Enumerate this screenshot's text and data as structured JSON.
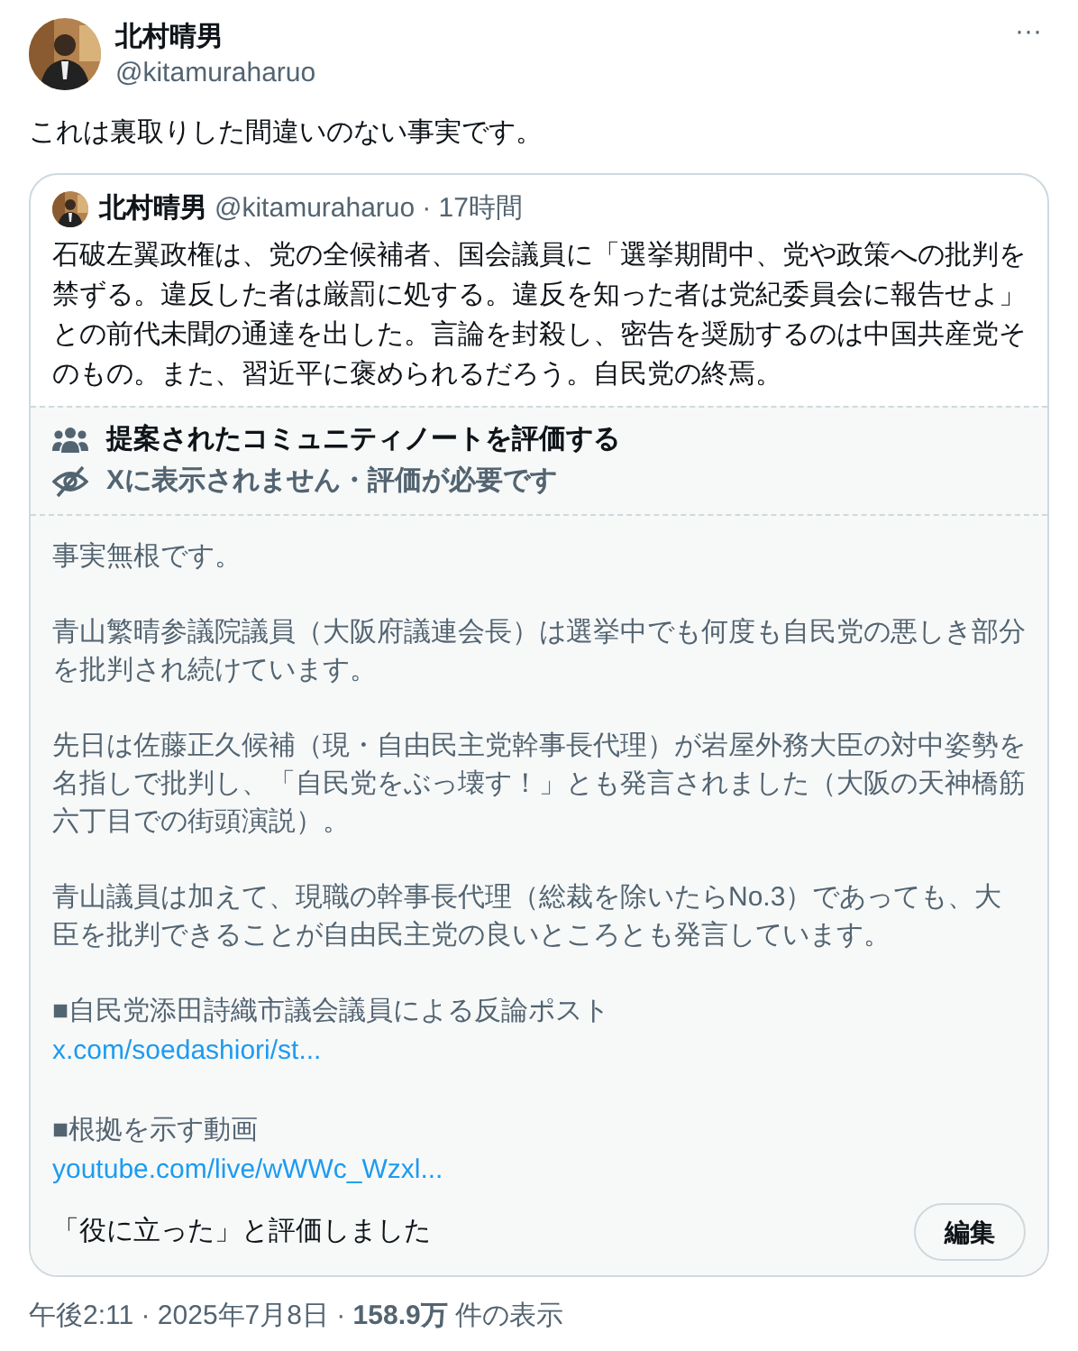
{
  "post": {
    "author": {
      "name": "北村晴男",
      "handle": "@kitamuraharuo"
    },
    "more": "···",
    "text": "これは裏取りした間違いのない事実です。"
  },
  "quote": {
    "author": {
      "name": "北村晴男",
      "handle": "@kitamuraharuo",
      "time": "· 17時間"
    },
    "text": "石破左翼政権は、党の全候補者、国会議員に「選挙期間中、党や政策への批判を禁ずる。違反した者は厳罰に処する。違反を知った者は党紀委員会に報告せよ」との前代未聞の通達を出した。言論を封殺し、密告を奨励するのは中国共産党そのもの。また、習近平に褒められるだろう。自民党の終焉。"
  },
  "note": {
    "header": "提案されたコミュニティノートを評価する",
    "status": "Xに表示されません・評価が必要です",
    "body": [
      {
        "kind": "text",
        "text": "事実無根です。"
      },
      {
        "kind": "text",
        "text": "青山繁晴参議院議員（大阪府議連会長）は選挙中でも何度も自民党の悪しき部分を批判され続けています。"
      },
      {
        "kind": "text",
        "text": "先日は佐藤正久候補（現・自由民主党幹事長代理）が岩屋外務大臣の対中姿勢を名指しで批判し、「自民党をぶっ壊す！」とも発言されました（大阪の天神橋筋六丁目での街頭演説）。"
      },
      {
        "kind": "text",
        "text": "青山議員は加えて、現職の幹事長代理（総裁を除いたらNo.3）であっても、大臣を批判できることが自由民主党の良いところとも発言しています。"
      },
      {
        "kind": "text",
        "text": "■自民党添田詩織市議会議員による反論ポスト"
      },
      {
        "kind": "link",
        "text": "x.com/soedashiori/st..."
      },
      {
        "kind": "text",
        "text": "■根拠を示す動画"
      },
      {
        "kind": "link",
        "text": "youtube.com/live/wWWc_Wzxl..."
      }
    ],
    "rating": "「役に立った」と評価しました",
    "edit_button": "編集"
  },
  "meta": "午後2:11 · 2025年7月8日 · **158.9万** 件の表示"
}
